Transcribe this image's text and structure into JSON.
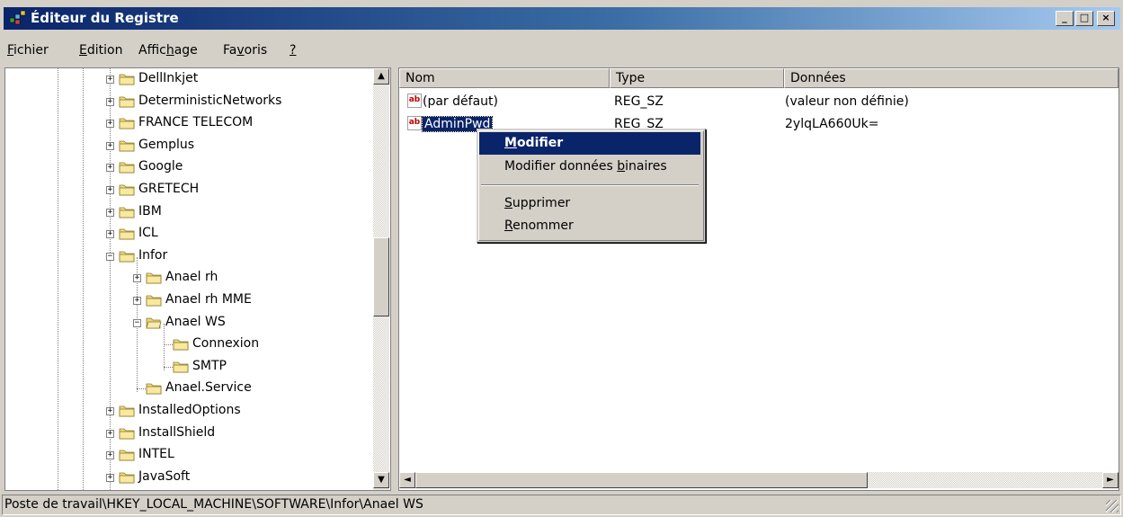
{
  "window": {
    "title": "Éditeur du Registre",
    "minimize": "_",
    "maximize": "□",
    "close": "×"
  },
  "menu": {
    "fichier": {
      "u": "F",
      "rest": "ichier"
    },
    "edition": {
      "u": "E",
      "rest": "dition"
    },
    "affichage": {
      "pre": "Affic",
      "u": "h",
      "rest": "age"
    },
    "favoris": {
      "pre": "Fa",
      "u": "v",
      "rest": "oris"
    },
    "help": {
      "u": "?"
    }
  },
  "tree": {
    "items": [
      {
        "label": "DellInkjet",
        "expander": "+"
      },
      {
        "label": "DeterministicNetworks",
        "expander": "+"
      },
      {
        "label": "FRANCE TELECOM",
        "expander": "+"
      },
      {
        "label": "Gemplus",
        "expander": "+"
      },
      {
        "label": "Google",
        "expander": "+"
      },
      {
        "label": "GRETECH",
        "expander": "+"
      },
      {
        "label": "IBM",
        "expander": "+"
      },
      {
        "label": "ICL",
        "expander": "+"
      },
      {
        "label": "Infor",
        "expander": "−"
      },
      {
        "label": "Anael rh",
        "expander": "+"
      },
      {
        "label": "Anael rh MME",
        "expander": "+"
      },
      {
        "label": "Anael WS",
        "expander": "−"
      },
      {
        "label": "Connexion",
        "expander": ""
      },
      {
        "label": "SMTP",
        "expander": ""
      },
      {
        "label": "Anael.Service",
        "expander": ""
      },
      {
        "label": "InstalledOptions",
        "expander": "+"
      },
      {
        "label": "InstallShield",
        "expander": "+"
      },
      {
        "label": "INTEL",
        "expander": "+"
      },
      {
        "label": "JavaSoft",
        "expander": "+"
      }
    ],
    "scroll_up": "▲",
    "scroll_down": "▼"
  },
  "list": {
    "columns": [
      "Nom",
      "Type",
      "Données"
    ],
    "rows": [
      {
        "icon": "ab",
        "name": "(par défaut)",
        "type": "REG_SZ",
        "data": "(valeur non définie)"
      },
      {
        "icon": "ab",
        "name": "AdminPwd",
        "type": "REG_SZ",
        "data": "2ylqLA660Uk="
      }
    ],
    "scroll_left": "◄",
    "scroll_right": "►"
  },
  "context_menu": {
    "modifier": {
      "u": "M",
      "rest": "odifier"
    },
    "modifier_binaire": {
      "pre": "Modifier données ",
      "u": "b",
      "rest": "inaires"
    },
    "supprimer": {
      "u": "S",
      "rest": "upprimer"
    },
    "renommer": {
      "u": "R",
      "rest": "enommer"
    }
  },
  "status": {
    "path": "Poste de travail\\HKEY_LOCAL_MACHINE\\SOFTWARE\\Infor\\Anael WS"
  }
}
